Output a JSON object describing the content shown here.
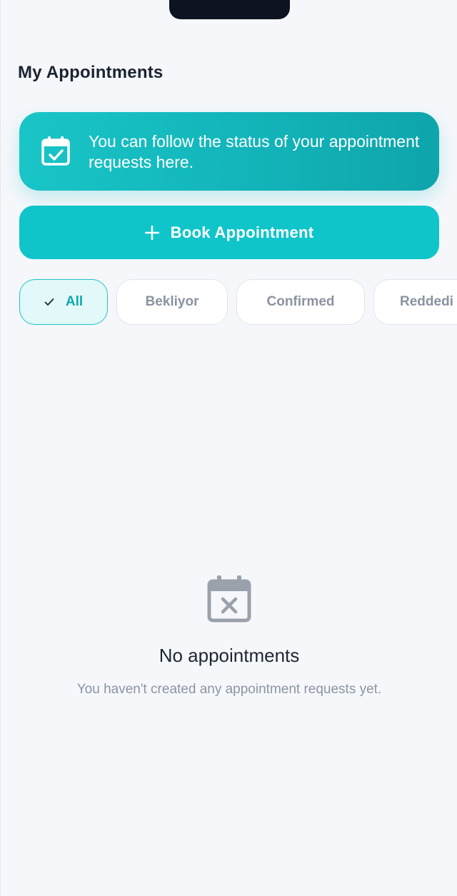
{
  "header": {
    "title": "My Appointments"
  },
  "info_banner": {
    "icon": "calendar-check-icon",
    "text": "You can follow the status of your appointment requests here."
  },
  "book_button": {
    "icon": "plus-icon",
    "label": "Book Appointment"
  },
  "filters": {
    "selected": "All",
    "chips": [
      {
        "label": "All",
        "active": true
      },
      {
        "label": "Bekliyor",
        "active": false
      },
      {
        "label": "Confirmed",
        "active": false
      },
      {
        "label": "Reddedi",
        "active": false
      }
    ]
  },
  "empty_state": {
    "icon": "calendar-x-icon",
    "title": "No appointments",
    "subtitle": "You haven't created any appointment requests yet."
  },
  "colors": {
    "accent": "#10c5c9",
    "accent_dark": "#12a7ae",
    "background": "#f5f7fb",
    "muted_text": "#8c95a3",
    "chip_active_bg": "#e2f8f9"
  }
}
